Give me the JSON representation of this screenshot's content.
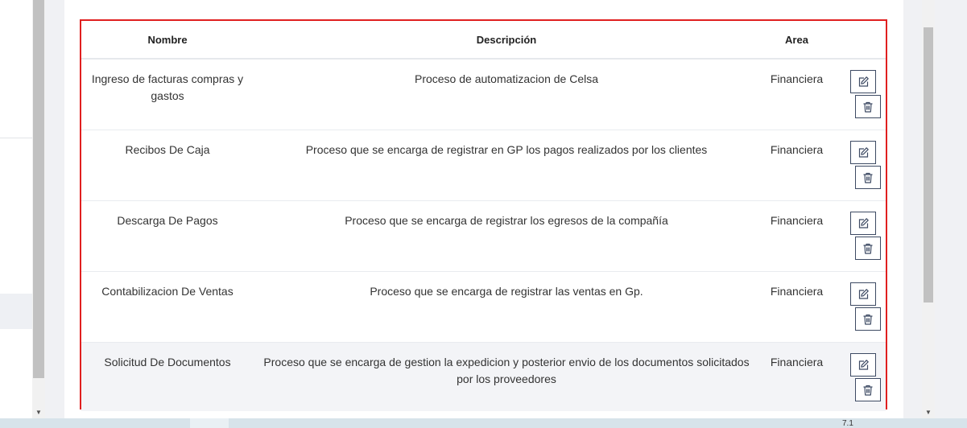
{
  "table": {
    "headers": {
      "nombre": "Nombre",
      "descripcion": "Descripción",
      "area": "Area"
    },
    "rows": [
      {
        "nombre": "Ingreso de facturas compras y gastos",
        "descripcion": "Proceso de automatizacion de Celsa",
        "area": "Financiera"
      },
      {
        "nombre": "Recibos De Caja",
        "descripcion": "Proceso que se encarga de registrar en GP los pagos realizados por los clientes",
        "area": "Financiera"
      },
      {
        "nombre": "Descarga De Pagos",
        "descripcion": "Proceso que se encarga de registrar los egresos de la compañía",
        "area": "Financiera"
      },
      {
        "nombre": "Contabilizacion De Ventas",
        "descripcion": "Proceso que se encarga de registrar las ventas en Gp.",
        "area": "Financiera"
      },
      {
        "nombre": "Solicitud De Documentos",
        "descripcion": "Proceso que se encarga de gestion la expedicion y posterior envio de los documentos solicitados por los proveedores",
        "area": "Financiera"
      }
    ],
    "actions": {
      "edit_icon": "edit-icon",
      "delete_icon": "trash-icon"
    }
  },
  "status_bar": {
    "text": "7.1"
  },
  "colors": {
    "highlight_border": "#e01f1f",
    "button_border": "#3d4a63",
    "alt_row": "#f3f4f7"
  }
}
